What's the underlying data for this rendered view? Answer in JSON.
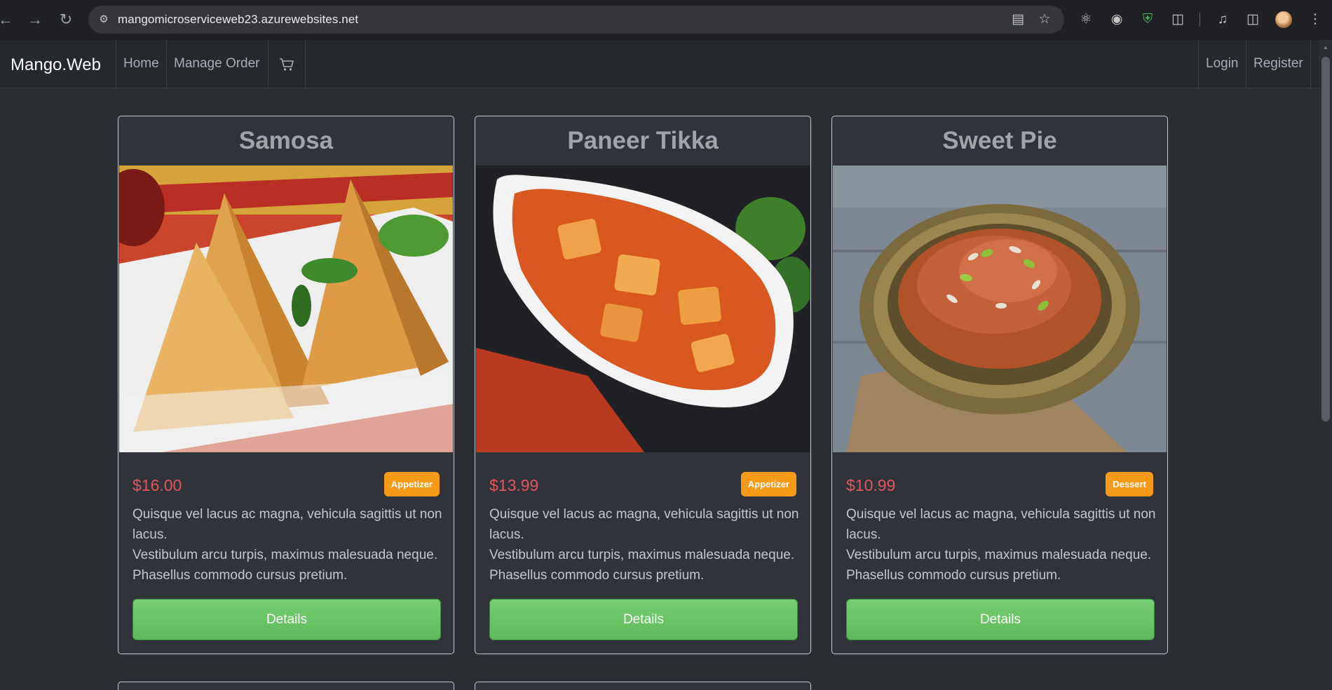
{
  "browser": {
    "url": "mangomicroserviceweb23.azurewebsites.net",
    "back_icon": "back-arrow-icon",
    "forward_icon": "forward-arrow-icon",
    "reload_icon": "reload-icon"
  },
  "navbar": {
    "brand": "Mango.Web",
    "links": [
      "Home",
      "Manage Order"
    ],
    "cart_icon": "cart-icon",
    "login": "Login",
    "register": "Register"
  },
  "products": [
    {
      "name": "Samosa",
      "price": "$16.00",
      "category": "Appetizer",
      "desc_line1": "Quisque vel lacus ac magna, vehicula sagittis ut non lacus.",
      "desc_line2": "Vestibulum arcu turpis, maximus malesuada neque.",
      "desc_line3": "Phasellus commodo cursus pretium.",
      "button": "Details"
    },
    {
      "name": "Paneer Tikka",
      "price": "$13.99",
      "category": "Appetizer",
      "desc_line1": "Quisque vel lacus ac magna, vehicula sagittis ut non lacus.",
      "desc_line2": "Vestibulum arcu turpis, maximus malesuada neque.",
      "desc_line3": "Phasellus commodo cursus pretium.",
      "button": "Details"
    },
    {
      "name": "Sweet Pie",
      "price": "$10.99",
      "category": "Dessert",
      "desc_line1": "Quisque vel lacus ac magna, vehicula sagittis ut non lacus.",
      "desc_line2": "Vestibulum arcu turpis, maximus malesuada neque.",
      "desc_line3": "Phasellus commodo cursus pretium.",
      "button": "Details"
    }
  ],
  "colors": {
    "page_bg": "#2a2e33",
    "card_bg": "#30343a",
    "price": "#e0555e",
    "badge": "#f79a17",
    "button": "#5cba5a"
  }
}
